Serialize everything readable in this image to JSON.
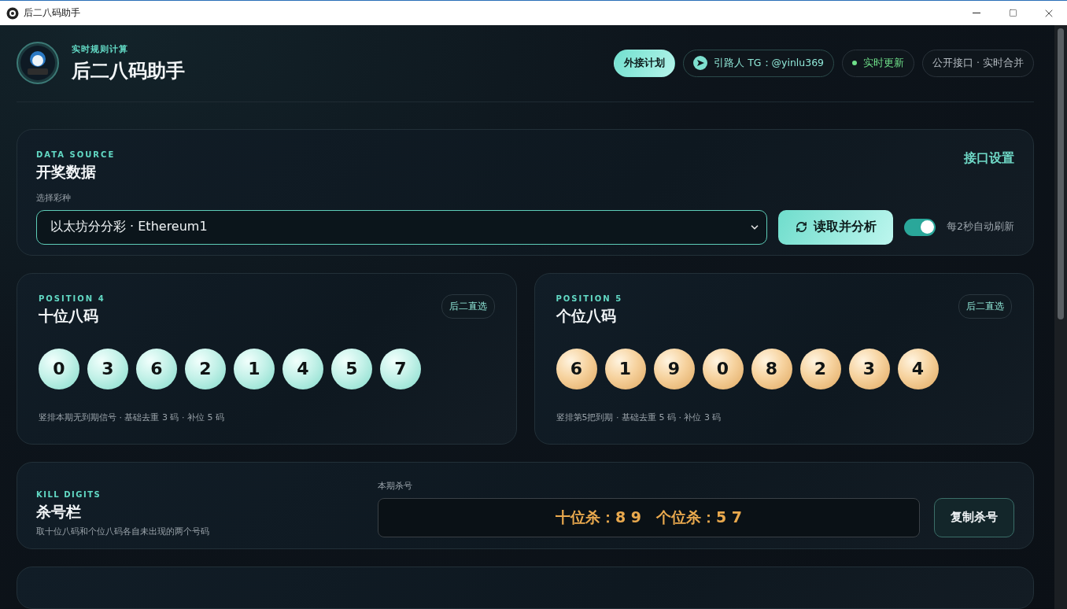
{
  "window": {
    "title": "后二八码助手"
  },
  "header": {
    "eyebrow": "实时规则计算",
    "title": "后二八码助手",
    "pills": [
      {
        "kind": "primary",
        "label": "外接计划"
      },
      {
        "kind": "telegram",
        "label": "引路人 TG：@yinlu369"
      },
      {
        "kind": "live",
        "label": "实时更新"
      },
      {
        "kind": "plain",
        "label": "公开接口 · 实时合并"
      }
    ]
  },
  "data_source": {
    "eyebrow": "DATA SOURCE",
    "title": "开奖数据",
    "settings_link": "接口设置",
    "select_label": "选择彩种",
    "select_value": "以太坊分分彩 · Ethereum1",
    "read_button": "读取并分析",
    "auto_refresh": {
      "on": true,
      "label": "每2秒自动刷新"
    }
  },
  "positions": [
    {
      "eyebrow": "POSITION 4",
      "title": "十位八码",
      "badge": "后二直选",
      "kind": "mint",
      "digits": [
        "0",
        "3",
        "6",
        "2",
        "1",
        "4",
        "5",
        "7"
      ],
      "note": "竖排本期无到期信号 · 基础去重 3 码 · 补位 5 码"
    },
    {
      "eyebrow": "POSITION 5",
      "title": "个位八码",
      "badge": "后二直选",
      "kind": "amber",
      "digits": [
        "6",
        "1",
        "9",
        "0",
        "8",
        "2",
        "3",
        "4"
      ],
      "note": "竖排第5把到期 · 基础去重 5 码 · 补位 3 码"
    }
  ],
  "kill": {
    "eyebrow": "KILL DIGITS",
    "title": "杀号栏",
    "description": "取十位八码和个位八码各自未出现的两个号码",
    "field_label": "本期杀号",
    "value": "十位杀：8 9　个位杀：5 7",
    "copy_button": "复制杀号"
  }
}
